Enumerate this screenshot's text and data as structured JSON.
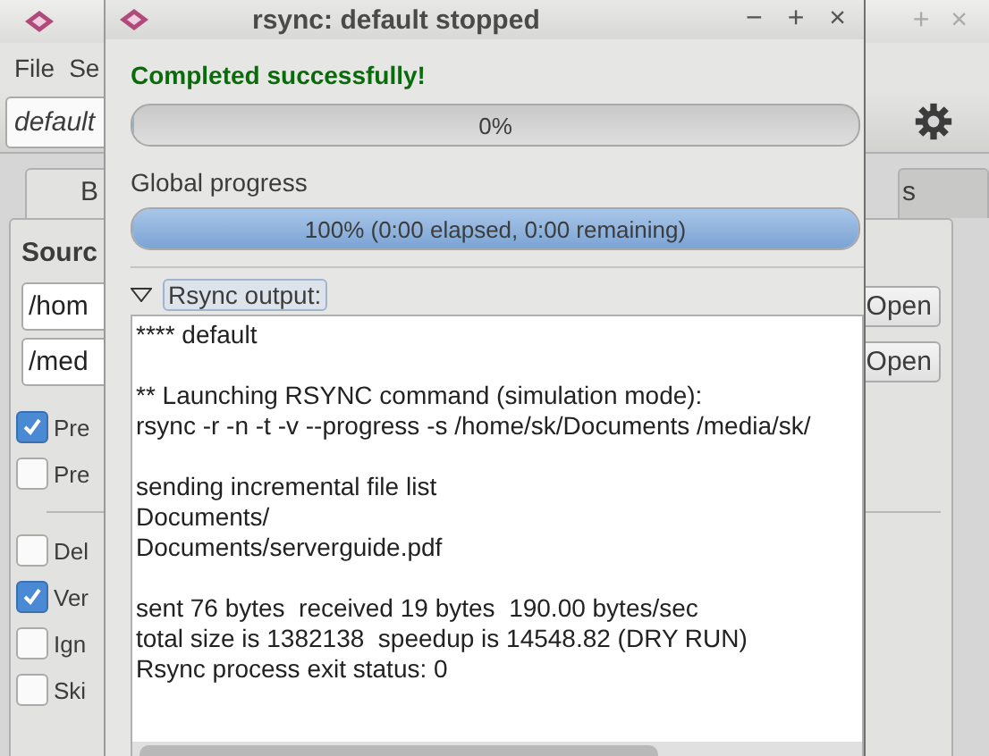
{
  "back_window": {
    "window_buttons": [
      "+",
      "×"
    ],
    "menu": [
      "File",
      "Se"
    ],
    "profile_combo": "default",
    "tabs": [
      {
        "label": "B",
        "selected": true
      },
      {
        "label": "s",
        "selected": false
      }
    ],
    "source_label": "Sourc",
    "paths": [
      {
        "value": "/hom",
        "button": "Open"
      },
      {
        "value": "/med",
        "button": "Open"
      }
    ],
    "options": [
      {
        "label": "Pre",
        "checked": true
      },
      {
        "label": "Pre",
        "checked": false
      }
    ],
    "more_options": [
      {
        "label": "Del",
        "checked": false
      },
      {
        "label": "Ver",
        "checked": true
      },
      {
        "label": "Ign",
        "checked": false
      },
      {
        "label": "Ski",
        "checked": false
      }
    ]
  },
  "dialog": {
    "title": "rsync: default stopped",
    "window_buttons": [
      "−",
      "+",
      "×"
    ],
    "status": "Completed successfully!",
    "file_progress": {
      "level": 0,
      "text": "0%"
    },
    "global_label": "Global progress",
    "global_progress": {
      "level": 1,
      "text": "100% (0:00 elapsed, 0:00 remaining)"
    },
    "output": {
      "label": "Rsync output:",
      "expanded": true,
      "paragraphs": [
        [
          "**** default"
        ],
        [
          "** Launching RSYNC command (simulation mode):",
          "rsync -r -n -t -v --progress -s /home/sk/Documents /media/sk/"
        ],
        [
          "sending incremental file list",
          "Documents/",
          "Documents/serverguide.pdf"
        ],
        [
          "sent 76 bytes  received 19 bytes  190.00 bytes/sec",
          "total size is 1382138  speedup is 14548.82 (DRY RUN)",
          "Rsync process exit status: 0"
        ]
      ]
    }
  }
}
